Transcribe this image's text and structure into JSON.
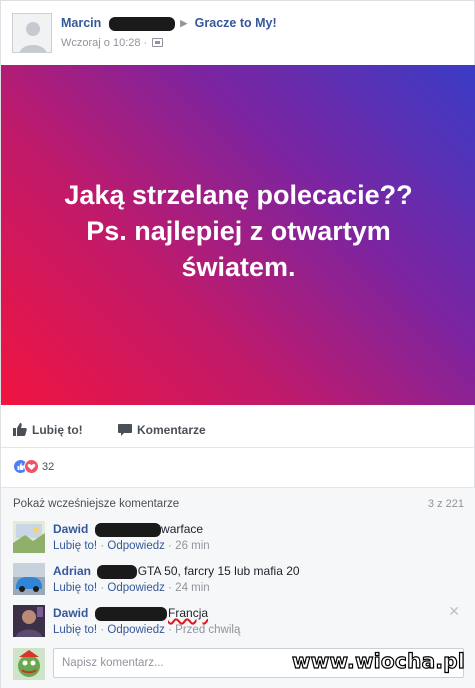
{
  "post": {
    "author": "Marcin",
    "group": "Gracze to My!",
    "timestamp": "Wczoraj o 10:28",
    "privacy_icon": "group-icon",
    "text_lines": [
      "Jaką strzelanę polecacie??",
      "Ps. najlepiej z otwartym",
      "światem."
    ],
    "gradient_colors": [
      "#f01440",
      "#7d24a0",
      "#3a3cc6"
    ]
  },
  "actions": {
    "like_label": "Lubię to!",
    "comment_label": "Komentarze"
  },
  "reactions": {
    "count": "32",
    "types": [
      "like",
      "love"
    ]
  },
  "comments_section": {
    "more_label": "Pokaż wcześniejsze komentarze",
    "count_label": "3 z 221",
    "items": [
      {
        "name": "Dawid",
        "text": "warface",
        "like": "Lubię to!",
        "reply": "Odpowiedz",
        "time": "26 min"
      },
      {
        "name": "Adrian",
        "text": "GTA 50, farcry 15 lub mafia 20",
        "like": "Lubię to!",
        "reply": "Odpowiedz",
        "time": "24 min"
      },
      {
        "name": "Dawid",
        "text": "Francja",
        "like": "Lubię to!",
        "reply": "Odpowiedz",
        "time": "Przed chwilą"
      }
    ],
    "separator": "·",
    "input_placeholder": "Napisz komentarz..."
  },
  "watermark": "www.wiocha.pl",
  "colors": {
    "link": "#365899",
    "muted": "#90949c",
    "like_reaction": "#4f7ff6",
    "love_reaction": "#f25268"
  }
}
